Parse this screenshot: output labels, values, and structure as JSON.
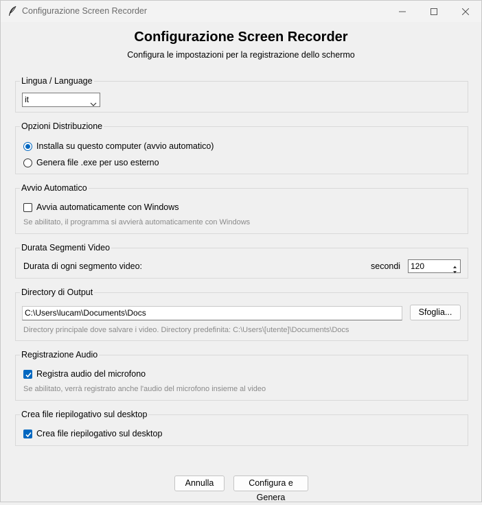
{
  "window": {
    "title": "Configurazione Screen Recorder",
    "icons": {
      "app": "feather-icon",
      "minimize": "minimize-icon",
      "maximize": "maximize-icon",
      "close": "close-icon"
    }
  },
  "header": {
    "title": "Configurazione Screen Recorder",
    "subtitle": "Configura le impostazioni per la registrazione dello schermo"
  },
  "language": {
    "group_label": "Lingua / Language",
    "selected": "it"
  },
  "distribution": {
    "group_label": "Opzioni Distribuzione",
    "options": [
      {
        "label": "Installa su questo computer (avvio automatico)",
        "selected": true
      },
      {
        "label": "Genera file .exe per uso esterno",
        "selected": false
      }
    ]
  },
  "autostart": {
    "group_label": "Avvio Automatico",
    "checkbox_label": "Avvia automaticamente con Windows",
    "checked": false,
    "hint": "Se abilitato, il programma si avvierà automaticamente con Windows"
  },
  "segments": {
    "group_label": "Durata Segmenti Video",
    "label": "Durata di ogni segmento video:",
    "unit": "secondi",
    "value": "120"
  },
  "output": {
    "group_label": "Directory di Output",
    "path": "C:\\Users\\lucam\\Documents\\Docs",
    "browse_label": "Sfoglia...",
    "hint": "Directory principale dove salvare i video. Directory predefinita: C:\\Users\\[utente]\\Documents\\Docs"
  },
  "audio": {
    "group_label": "Registrazione Audio",
    "checkbox_label": "Registra audio del microfono",
    "checked": true,
    "hint": "Se abilitato, verrà registrato anche l'audio del microfono insieme al video"
  },
  "summary": {
    "group_label": "Crea file riepilogativo sul desktop",
    "checkbox_label": "Crea file riepilogativo sul desktop",
    "checked": true
  },
  "footer": {
    "cancel_label": "Annulla",
    "submit_label": "Configura e Genera"
  },
  "colors": {
    "accent": "#0067c0",
    "background": "#f0f0f0",
    "hint": "#8a8a8a"
  }
}
